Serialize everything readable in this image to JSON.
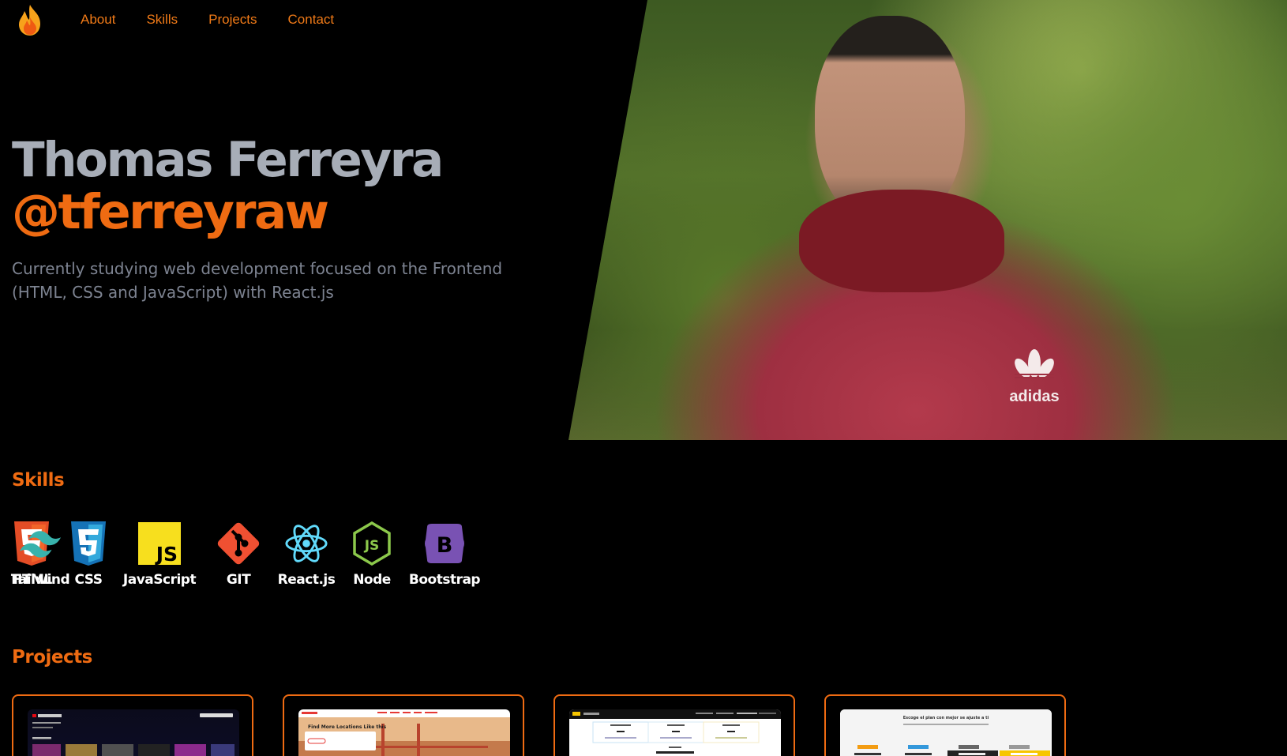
{
  "nav": {
    "logo_icon": "flame-icon",
    "links": [
      "About",
      "Skills",
      "Projects",
      "Contact"
    ],
    "color": "#f07a17"
  },
  "hero": {
    "name": "Thomas Ferreyra",
    "handle": "@tferreyraw",
    "description": "Currently studying web development focused on the Frontend (HTML, CSS and JavaScript) with React.js",
    "photo_logo_text": "adidas"
  },
  "skills": {
    "title": "Skills",
    "items": [
      {
        "label": "HTML",
        "icon": "html5-icon",
        "color": "#e44d26"
      },
      {
        "label": "CSS",
        "icon": "css3-icon",
        "color": "#1572b6"
      },
      {
        "label": "JavaScript",
        "icon": "javascript-icon",
        "color": "#f7df1e"
      },
      {
        "label": "GIT",
        "icon": "git-icon",
        "color": "#f05032"
      },
      {
        "label": "React.js",
        "icon": "react-icon",
        "color": "#61dafb"
      },
      {
        "label": "Node",
        "icon": "nodejs-icon",
        "color": "#8cc84b"
      },
      {
        "label": "Bootstrap",
        "icon": "bootstrap-icon",
        "color": "#7952b3"
      },
      {
        "label": "Tailwind",
        "icon": "tailwind-icon",
        "color": "#38b2ac"
      }
    ]
  },
  "projects": {
    "title": "Projects",
    "items": [
      {
        "name": "project-1"
      },
      {
        "name": "project-2",
        "heading": "Find More Locations Like this"
      },
      {
        "name": "project-3"
      },
      {
        "name": "project-4",
        "heading": "Escoge el plan con mejor se ajuste a ti"
      }
    ]
  },
  "colors": {
    "accent": "#ef6b12",
    "name_gray": "#a7adb7",
    "text_gray": "#7d8391",
    "background": "#000000"
  }
}
